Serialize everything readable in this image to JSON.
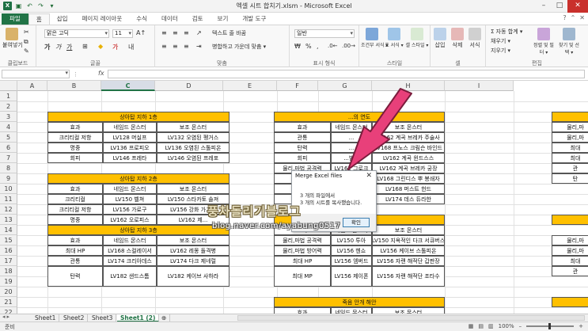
{
  "window": {
    "title": "엑셀 시트 합치기.xlsm - Microsoft Excel"
  },
  "tabs": [
    "파일",
    "홈",
    "삽입",
    "페이지 레이아웃",
    "수식",
    "데이터",
    "검토",
    "보기",
    "개발 도구"
  ],
  "ribbon": {
    "paste_label": "붙여넣기",
    "font_name": "맑은 고딕",
    "font_size": "11",
    "wrap_text": "텍스트 줄 바꿈",
    "merge_center": "병합하고 가운데 맞춤 ▾",
    "number_format": "일반",
    "cond_format": "조건부 서식 ▾",
    "table_format": "표 서식 ▾",
    "cell_style": "셀 스타일 ▾",
    "insert": "삽입",
    "delete": "삭제",
    "format": "서식",
    "autosum": "Σ 자동 합계 ▾",
    "fill": "채우기 ▾",
    "clear": "지우기 ▾",
    "sort_filter": "정렬 및 필터 ▾",
    "find_select": "찾기 및 선택 ▾",
    "groups": [
      "클립보드",
      "글꼴",
      "맞춤",
      "표시 형식",
      "스타일",
      "셀",
      "편집"
    ]
  },
  "columns": [
    "A",
    "B",
    "C",
    "D",
    "E",
    "F",
    "G",
    "H",
    "I"
  ],
  "selected_column": "C",
  "rows": [
    "1",
    "2",
    "3",
    "4",
    "5",
    "6",
    "7",
    "8",
    "9",
    "10",
    "11",
    "12",
    "13",
    "14",
    "15",
    "16",
    "17",
    "18",
    "19",
    "20",
    "21",
    "22"
  ],
  "tables_left": [
    {
      "title": "상아탑 지하 1층",
      "headers": [
        "효과",
        "네임드 몬스터",
        "보조 몬스터"
      ],
      "rows": [
        [
          "크리티컬 저항",
          "LV128 머실프",
          "LV132 오염된 펭거스"
        ],
        [
          "명중",
          "LV136 프로피오",
          "LV136 오염된 스톨피온"
        ],
        [
          "회피",
          "LV146 프레타",
          "LV146 오염된 프레포"
        ]
      ]
    },
    {
      "title": "상아탑 지하 2층",
      "headers": [
        "효과",
        "네임드 몬스터",
        "보조 몬스터"
      ],
      "rows": [
        [
          "크리티컬",
          "LV150 벨쳐",
          "LV150 스타카토 솔져"
        ],
        [
          "크리티컬 저항",
          "LV156 가로구",
          "LV156 강화 가고일"
        ],
        [
          "명중",
          "LV162 오로피스",
          "LV162 제..."
        ]
      ]
    },
    {
      "title": "상아탑 지하 3층",
      "headers": [
        "효과",
        "네임드 몬스터",
        "보조 몬스터"
      ],
      "rows": [
        [
          "최대 HP",
          "LV168 스컬레이서",
          "LV162 레몽 돌격병"
        ],
        [
          "관통",
          "LV174 크리아데스",
          "LV174 다크 제네럴"
        ],
        [
          "탄력",
          "LV182 샌드스톰",
          "LV182 케이브 사하라"
        ]
      ]
    }
  ],
  "tables_right": {
    "title1": "...의 연도",
    "headers": [
      "효과",
      "네임드 몬스터",
      "보조 몬스터"
    ],
    "rows1": [
      [
        "관통",
        "...",
        "LV162 계곡 브레카 주술사"
      ],
      [
        "탄력",
        "...",
        "LV168 프노스 크림슨 바인드"
      ],
      [
        "회피",
        "...빌론",
        "LV162 계곡 윈드스스"
      ],
      [
        "물리,마법 공격력",
        "LV162 그로크",
        "LV162 계곡 브레카 궁장"
      ],
      [
        "...",
        "...올바",
        "LV168 그린디스 뿌 봉쇄자"
      ],
      [
        "...",
        "...가즈나",
        "LV168 머스트 헌드"
      ],
      [
        "...",
        "...볼라스",
        "LV174 데스 듀라한"
      ]
    ],
    "title2": "...막아성",
    "rows2": [
      [
        "물리,마법 공격력",
        "LV150 투아",
        "LV150 지옥적인 다크 서큐버스"
      ],
      [
        "물리,마법 방어력",
        "LV156 헨쇼",
        "LV156 케이브 스톨피온"
      ],
      [
        "최대 HP",
        "LV156 엠버드",
        "LV156 자랜 해적단 갑판장"
      ],
      [
        "최대 MP",
        "LV156 제이폰",
        "LV156 자랜 해적단 조타수"
      ]
    ],
    "title3": "죽음 안개 해안",
    "partial_right": [
      "물리,마",
      "물리,마",
      "최대",
      "최대",
      "관",
      "탄",
      "물리,마",
      "물리,마",
      "최대",
      "관"
    ]
  },
  "dialog": {
    "title": "Merge Excel files",
    "line1": "3 개의 파일에서",
    "line2": "3 개의 시트를 복사했습니다.",
    "ok": "확인"
  },
  "watermark": {
    "line1": "풍차돌리기블로그",
    "line2": "blog.naver.com/ayabung0517"
  },
  "sheets": [
    "Sheet1",
    "Sheet2",
    "Sheet3",
    "Sheet1 (2)"
  ],
  "active_sheet": "Sheet1 (2)",
  "status": {
    "left": "준비",
    "zoom": "100%"
  },
  "colors": {
    "header_fill": "#ffc000",
    "excel_green": "#217346",
    "arrow": "#e8407a"
  }
}
